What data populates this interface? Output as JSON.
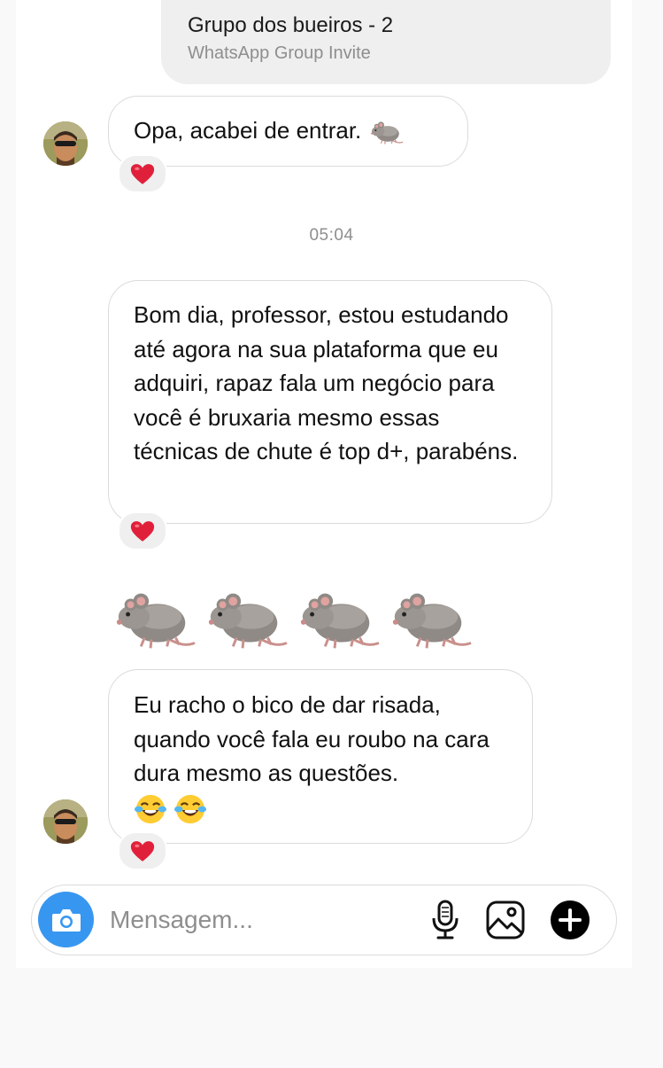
{
  "invite": {
    "title": "Grupo dos bueiros - 2",
    "subtitle": "WhatsApp Group Invite"
  },
  "messages": [
    {
      "text": "Opa, acabei de entrar.",
      "trailing_emoji": "rat",
      "reaction": "red-heart"
    },
    {
      "text": "Bom dia, professor, estou estudando até agora na sua plataforma que eu adquiri, rapaz fala um negócio para você é bruxaria mesmo essas técnicas de chute é top d+, parabéns.",
      "reaction": "red-heart"
    },
    {
      "emoji_only": [
        "rat",
        "rat",
        "rat",
        "rat"
      ]
    },
    {
      "text": "Eu racho o bico de dar risada, quando você fala eu roubo na cara dura mesmo as questões.",
      "trailing_emoji": [
        "face-with-tears-of-joy",
        "face-with-tears-of-joy"
      ],
      "reaction": "red-heart"
    }
  ],
  "timestamp": "05:04",
  "composer": {
    "placeholder": "Mensagem...",
    "accent_color": "#3797f0"
  }
}
